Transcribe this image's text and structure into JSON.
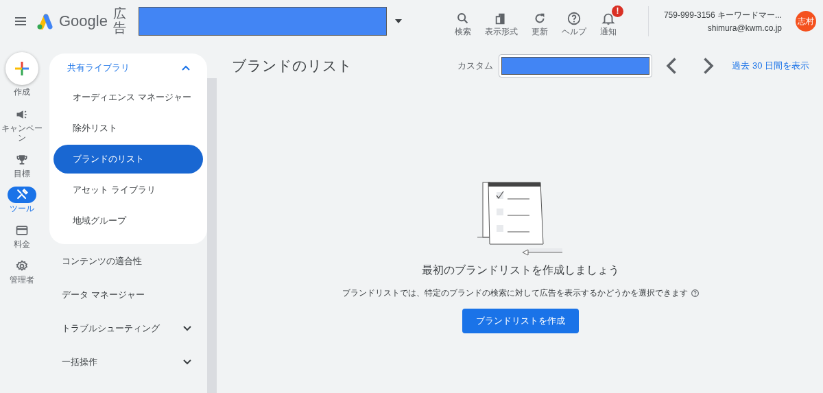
{
  "header": {
    "logo_text": "Google",
    "product": "広告",
    "tools": [
      {
        "label": "検索",
        "kind": "search"
      },
      {
        "label": "表示形式",
        "kind": "chart"
      },
      {
        "label": "更新",
        "kind": "refresh"
      },
      {
        "label": "ヘルプ",
        "kind": "help"
      },
      {
        "label": "通知",
        "kind": "bell",
        "badge": "!"
      }
    ],
    "account": {
      "line1": "759-999-3156 キーワードマー...",
      "email": "shimura@kwm.co.jp",
      "avatar": "志村"
    }
  },
  "create": {
    "label": "作成"
  },
  "rail": [
    {
      "label": "キャンペーン",
      "kind": "megaphone",
      "selected": false
    },
    {
      "label": "目標",
      "kind": "trophy",
      "selected": false
    },
    {
      "label": "ツール",
      "kind": "tools",
      "selected": true
    },
    {
      "label": "料金",
      "kind": "card",
      "selected": false
    },
    {
      "label": "管理者",
      "kind": "gear",
      "selected": false
    }
  ],
  "sidebar": {
    "group": {
      "label": "共有ライブラリ",
      "expanded": true,
      "children": [
        {
          "label": "オーディエンス マネージャー",
          "selected": false
        },
        {
          "label": "除外リスト",
          "selected": false
        },
        {
          "label": "ブランドのリスト",
          "selected": true
        },
        {
          "label": "アセット ライブラリ",
          "selected": false
        },
        {
          "label": "地域グループ",
          "selected": false
        }
      ]
    },
    "items": [
      {
        "label": "コンテンツの適合性",
        "kind": "link"
      },
      {
        "label": "データ マネージャー",
        "kind": "link"
      },
      {
        "label": "トラブルシューティング",
        "kind": "expandable"
      },
      {
        "label": "一括操作",
        "kind": "expandable"
      }
    ]
  },
  "main": {
    "title": "ブランドのリスト",
    "date_label": "カスタム",
    "date_link": "過去 30 日間を表示",
    "empty": {
      "heading": "最初のブランドリストを作成しましょう",
      "description": "ブランドリストでは、特定のブランドの検索に対して広告を表示するかどうかを選択できます",
      "button": "ブランドリストを作成"
    }
  }
}
